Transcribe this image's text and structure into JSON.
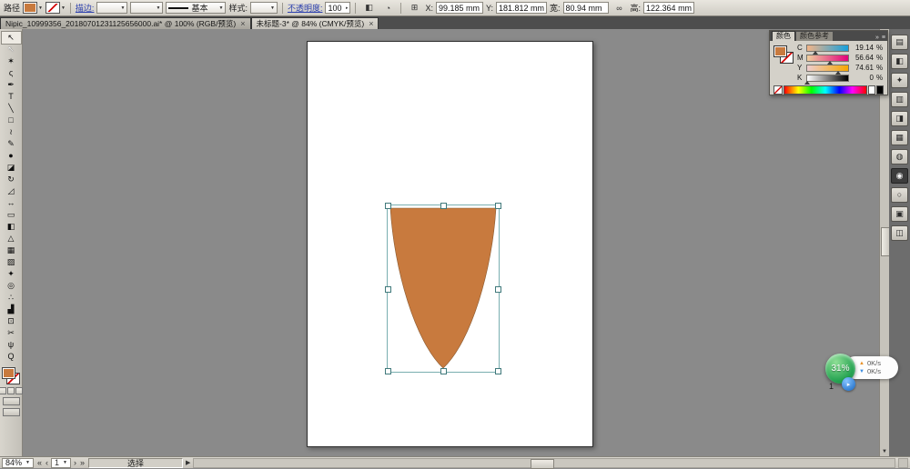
{
  "colors": {
    "shape_fill": "#c87a3e",
    "selection_accent": "#79aeb0",
    "speedball_green": "#25a351",
    "chrome": "#d4d1c9",
    "canvas": "#8a8a8a"
  },
  "icons": {
    "dropdown": "▼",
    "dropdown_small": "▾",
    "spinner": "▸",
    "flyout": "▶",
    "up_arrow": "▲",
    "down_arrow": "▼",
    "link": "∞",
    "menu": "≡",
    "expand": "»",
    "nav_first": "«",
    "nav_prev": "‹",
    "nav_next": "›",
    "nav_last": "»"
  },
  "control_bar": {
    "object_label": "路径",
    "stroke_link": "描边:",
    "profile_value": "基本",
    "style_label": "样式:",
    "opacity_link": "不透明度:",
    "opacity_value": "100",
    "extra_icons": [
      {
        "name": "shape-mode-icon",
        "glyph": "◧"
      },
      {
        "name": "recolor-artwork-icon",
        "glyph": "◔"
      },
      {
        "name": "align-reference-icon",
        "glyph": "⊞"
      }
    ],
    "x_label": "X:",
    "x_value": "99.185 mm",
    "y_label": "Y:",
    "y_value": "181.812 mm",
    "w_label": "宽:",
    "w_value": "80.94 mm",
    "h_label": "高:",
    "h_value": "122.364 mm"
  },
  "tabs": [
    {
      "label": "Nipic_10999356_20180701231125656000.ai* @ 100% (RGB/预览)",
      "close": "×"
    },
    {
      "label": "未标题-3* @ 84% (CMYK/预览)",
      "close": "×"
    }
  ],
  "tools": [
    {
      "name": "selection",
      "glyph": "↖"
    },
    {
      "name": "direct-selection",
      "glyph": "↖"
    },
    {
      "name": "magic-wand",
      "glyph": "✶"
    },
    {
      "name": "lasso",
      "glyph": "ς"
    },
    {
      "name": "pen",
      "glyph": "✒"
    },
    {
      "name": "type",
      "glyph": "T"
    },
    {
      "name": "line-segment",
      "glyph": "╲"
    },
    {
      "name": "rectangle",
      "glyph": "□"
    },
    {
      "name": "paintbrush",
      "glyph": "≀"
    },
    {
      "name": "pencil",
      "glyph": "✎"
    },
    {
      "name": "blob-brush",
      "glyph": "●"
    },
    {
      "name": "eraser",
      "glyph": "◪"
    },
    {
      "name": "rotate",
      "glyph": "↻"
    },
    {
      "name": "scale",
      "glyph": "◿"
    },
    {
      "name": "width",
      "glyph": "↔"
    },
    {
      "name": "free-transform",
      "glyph": "▭"
    },
    {
      "name": "shape-builder",
      "glyph": "◧"
    },
    {
      "name": "perspective-grid",
      "glyph": "△"
    },
    {
      "name": "mesh",
      "glyph": "▦"
    },
    {
      "name": "gradient",
      "glyph": "▨"
    },
    {
      "name": "eyedropper",
      "glyph": "✦"
    },
    {
      "name": "blend",
      "glyph": "◎"
    },
    {
      "name": "symbol-sprayer",
      "glyph": "∴"
    },
    {
      "name": "column-graph",
      "glyph": "▟"
    },
    {
      "name": "artboard",
      "glyph": "⊡"
    },
    {
      "name": "slice",
      "glyph": "✂"
    },
    {
      "name": "hand",
      "glyph": "ψ"
    },
    {
      "name": "zoom",
      "glyph": "Q"
    }
  ],
  "color_panel": {
    "tab_active": "颜色",
    "tab_inactive": "颜色参考",
    "channels": [
      {
        "label": "C",
        "value": "19.14",
        "unit": "%"
      },
      {
        "label": "M",
        "value": "56.64",
        "unit": "%"
      },
      {
        "label": "Y",
        "value": "74.61",
        "unit": "%"
      },
      {
        "label": "K",
        "value": "0",
        "unit": "%"
      }
    ]
  },
  "dock": {
    "icons": [
      {
        "name": "dock-panel-icon-1",
        "glyph": "▤"
      },
      {
        "name": "dock-panel-icon-2",
        "glyph": "◧"
      },
      {
        "name": "dock-panel-icon-3",
        "glyph": "✦"
      },
      {
        "name": "dock-panel-icon-4",
        "glyph": "▥"
      },
      {
        "name": "dock-panel-icon-5",
        "glyph": "◨"
      },
      {
        "name": "dock-panel-icon-6",
        "glyph": "▦"
      },
      {
        "name": "dock-panel-icon-7",
        "glyph": "◍"
      },
      {
        "name": "dock-panel-icon-8",
        "glyph": "◉"
      },
      {
        "name": "dock-panel-icon-9",
        "glyph": "○"
      },
      {
        "name": "dock-panel-icon-10",
        "glyph": "▣"
      },
      {
        "name": "dock-panel-icon-11",
        "glyph": "◫"
      }
    ]
  },
  "status_bar": {
    "zoom": "84%",
    "artboard": "1",
    "status": "选择"
  },
  "speed_ball": {
    "percent": "31%",
    "up_label": "0K/s",
    "down_label": "0K/s",
    "badge": "1"
  }
}
